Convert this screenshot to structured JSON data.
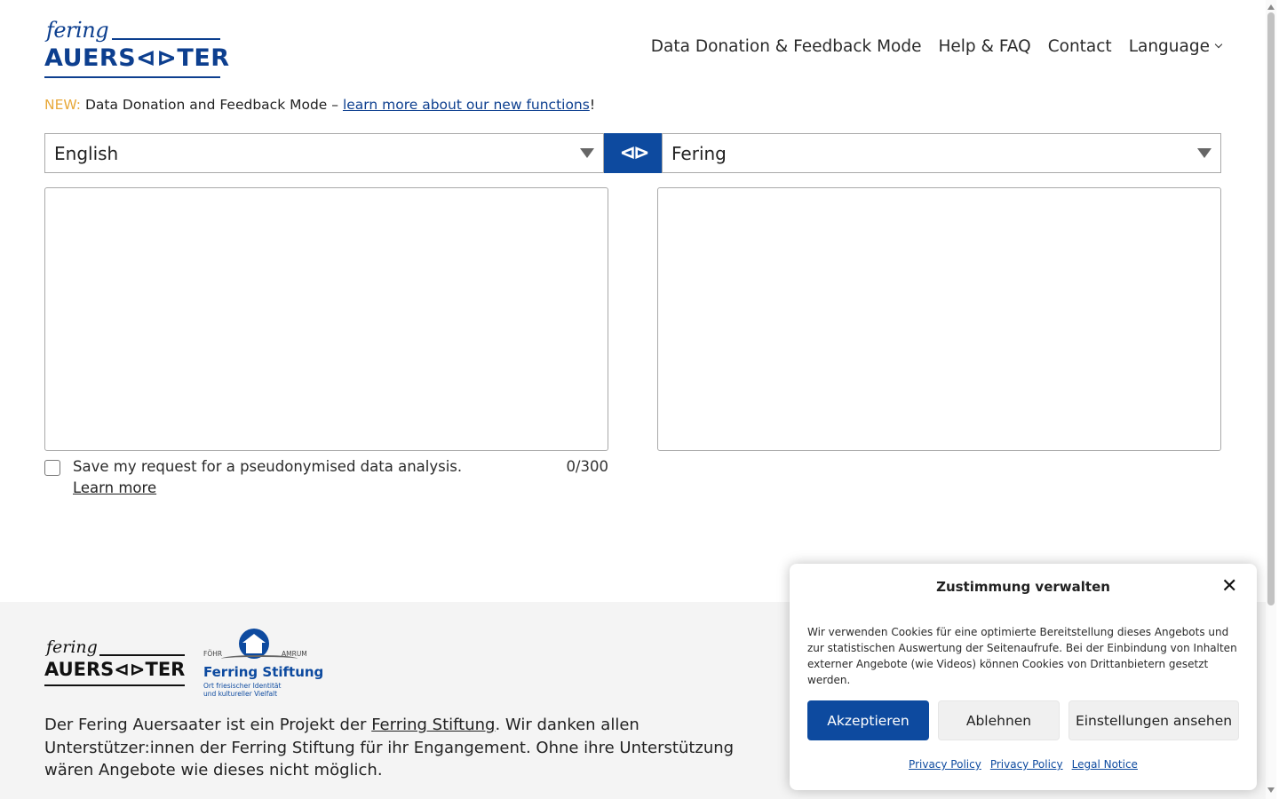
{
  "header": {
    "logo_top": "fering",
    "logo_main": "AUERS⊲⊳TER",
    "nav": [
      "Data Donation & Feedback Mode",
      "Help & FAQ",
      "Contact",
      "Language"
    ]
  },
  "notice": {
    "new_label": "NEW:",
    "text": "Data Donation and Feedback Mode –",
    "link": "learn more about our new functions",
    "end": "!"
  },
  "translator": {
    "source_lang": "English",
    "target_lang": "Fering",
    "swap_symbol": "⊲⊳",
    "source_text": "",
    "target_text": "",
    "save_label": "Save my request for a pseudonymised data analysis.",
    "learn_more": "Learn more",
    "counter": "0/300"
  },
  "footer": {
    "logo_top": "fering",
    "logo_main": "AUERS⊲⊳TER",
    "stiftung_left": "FÖHR",
    "stiftung_right": "AMRUM",
    "stiftung_name": "Ferring Stiftung",
    "stiftung_sub_1": "Ort friesischer Identität",
    "stiftung_sub_2": "und kultureller Vielfalt",
    "text_1": "Der Fering Auersaater ist ein Projekt der",
    "link": "Ferring Stiftung",
    "text_2": ". Wir danken allen Unterstützer:innen der Ferring Stiftung für ihr Engangement. Ohne ihre Unterstützung wären Angebote wie dieses nicht möglich."
  },
  "cookie": {
    "title": "Zustimmung verwalten",
    "close": "✕",
    "body": "Wir verwenden Cookies für eine optimierte Bereitstellung dieses Angebots und zur statistischen Auswertung der Seitenaufrufe. Bei der Einbindung von Inhalten externer Angebote (wie Videos) können Cookies von Drittanbietern gesetzt werden.",
    "accept": "Akzeptieren",
    "deny": "Ablehnen",
    "settings": "Einstellungen ansehen",
    "links": [
      "Privacy Policy",
      "Privacy Policy",
      "Legal Notice"
    ]
  },
  "colors": {
    "brand_blue": "#0d4a9f",
    "new_accent": "#e8a93a"
  }
}
